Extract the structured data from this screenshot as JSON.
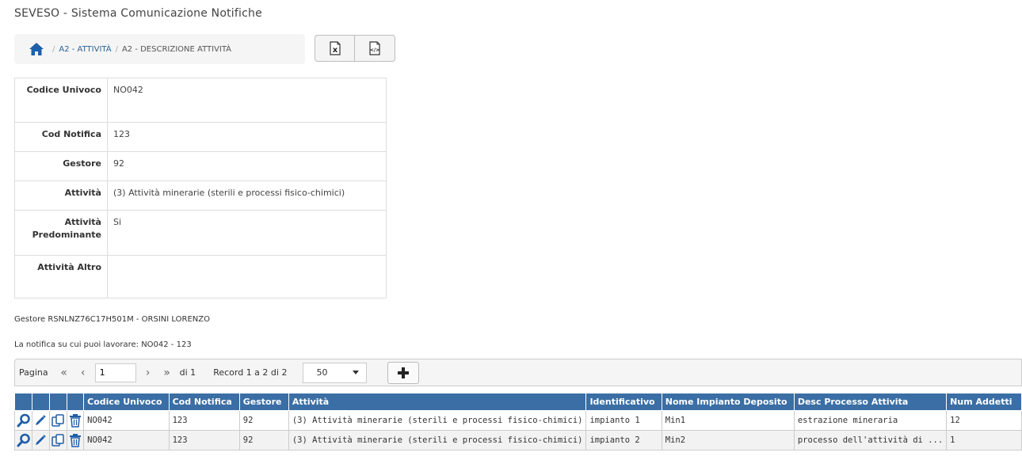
{
  "app": {
    "title": "SEVESO - Sistema Comunicazione Notifiche"
  },
  "breadcrumb": {
    "home_icon": "home-icon",
    "items": [
      "A2 - ATTIVITÀ",
      "A2 - DESCRIZIONE ATTIVITÀ"
    ],
    "separator": "/"
  },
  "export": {
    "excel_icon": "excel-export-icon",
    "xml_icon": "xml-export-icon"
  },
  "detail": [
    {
      "label": "Codice Univoco",
      "value": "NO042"
    },
    {
      "label": "Cod Notifica",
      "value": "123"
    },
    {
      "label": "Gestore",
      "value": "92"
    },
    {
      "label": "Attività",
      "value": "(3) Attività minerarie (sterili e processi fisico-chimici)"
    },
    {
      "label": "Attività Predominante",
      "value": "Si"
    },
    {
      "label": "Attività Altro",
      "value": ""
    }
  ],
  "info": {
    "gestore": "Gestore RSNLNZ76C17H501M - ORSINI LORENZO",
    "notifica": "La notifica su cui puoi lavorare: NO042 - 123"
  },
  "pager": {
    "label": "Pagina",
    "page": "1",
    "of": "di 1",
    "records": "Record 1 a 2 di 2",
    "page_size": "50",
    "first": "«",
    "prev": "‹",
    "next": "›",
    "last": "»"
  },
  "grid": {
    "columns": [
      "Codice Univoco",
      "Cod Notifica",
      "Gestore",
      "Attività",
      "Identificativo",
      "Nome Impianto Deposito",
      "Desc Processo Attivita",
      "Num Addetti"
    ],
    "rows": [
      [
        "NO042",
        "123",
        "92",
        "(3) Attività minerarie (sterili e processi fisico-chimici)",
        "impianto 1",
        "Min1",
        "estrazione mineraria",
        "12"
      ],
      [
        "NO042",
        "123",
        "92",
        "(3) Attività minerarie (sterili e processi fisico-chimici)",
        "impianto 2",
        "Min2",
        "processo dell'attività di ...",
        "1"
      ]
    ]
  },
  "colors": {
    "header_bg": "#3a6ea5",
    "icon_blue": "#1f5fa8",
    "link": "#2a6496"
  }
}
